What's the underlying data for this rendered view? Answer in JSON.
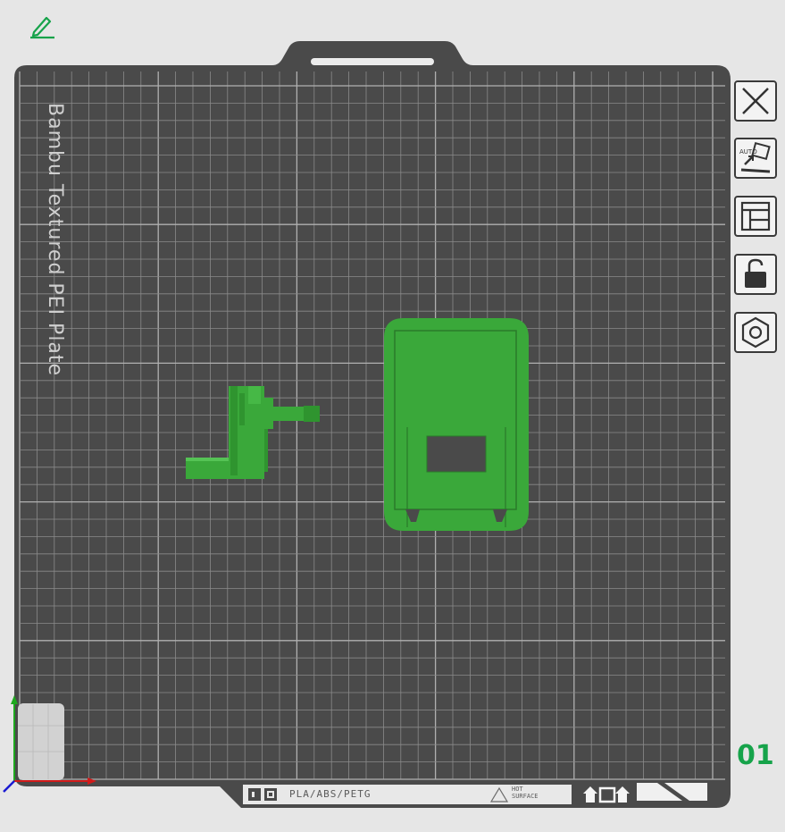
{
  "plate": {
    "name": "Bambu Textured PEI Plate",
    "number": "01",
    "filament_label": "PLA/ABS/PETG",
    "hot_surface_line1": "HOT",
    "hot_surface_line2": "SURFACE"
  },
  "toolbar": {
    "icons": [
      "close-icon",
      "auto-orient-icon",
      "arrange-icon",
      "lock-icon",
      "settings-nut-icon"
    ]
  },
  "colors": {
    "plate_bg": "#4a4a4a",
    "grid_line": "#8a8a8a",
    "model": "#3aa83a",
    "accent": "#16a34a"
  }
}
